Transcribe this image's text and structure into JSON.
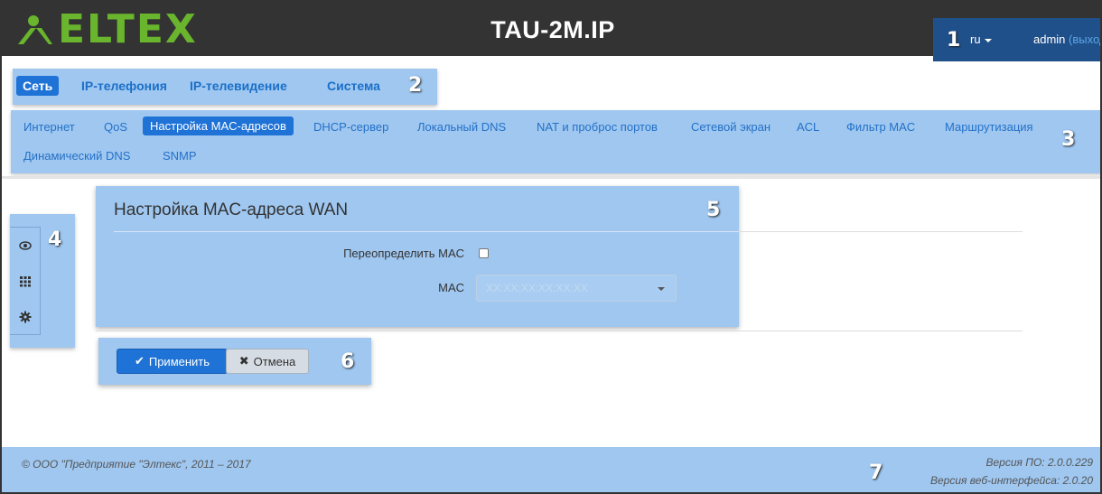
{
  "header": {
    "brand": "ELTEX",
    "title": "TAU-2M.IP",
    "language": "ru",
    "user": "admin",
    "logout": "(выход)"
  },
  "markers": [
    "1",
    "2",
    "3",
    "4",
    "5",
    "6",
    "7"
  ],
  "main_nav": [
    {
      "label": "Сеть",
      "active": true
    },
    {
      "label": "IP-телефония",
      "active": false
    },
    {
      "label": "IP-телевидение",
      "active": false
    },
    {
      "label": "Система",
      "active": false
    }
  ],
  "sub_nav": [
    {
      "label": "Интернет",
      "active": false
    },
    {
      "label": "QoS",
      "active": false
    },
    {
      "label": "Настройка MAC-адресов",
      "active": true
    },
    {
      "label": "DHCP-сервер",
      "active": false
    },
    {
      "label": "Локальный DNS",
      "active": false
    },
    {
      "label": "NAT и проброс портов",
      "active": false
    },
    {
      "label": "Сетевой экран",
      "active": false
    },
    {
      "label": "ACL",
      "active": false
    },
    {
      "label": "Фильтр MAC",
      "active": false
    },
    {
      "label": "Маршрутизация",
      "active": false
    },
    {
      "label": "Динамический DNS",
      "active": false
    },
    {
      "label": "SNMP",
      "active": false
    }
  ],
  "side_toolbar": {
    "icons": [
      "eye-icon",
      "grid-icon",
      "gear-icon"
    ]
  },
  "panel": {
    "title": "Настройка MAC-адреса WAN",
    "override_label": "Переопределить MAC",
    "override_checked": false,
    "mac_label": "MAC",
    "mac_placeholder": "XX:XX:XX:XX:XX:XX"
  },
  "actions": {
    "apply": "Применить",
    "cancel": "Отмена"
  },
  "footer": {
    "copyright": "© ООО \"Предприятие \"Элтекс\", 2011 – 2017",
    "firmware": "Версия ПО: 2.0.0.229",
    "web_version": "Версия веб-интерфейса: 2.0.20"
  },
  "colors": {
    "header_bg": "#333333",
    "accent": "#1f73d6",
    "highlight": "#9fc7f0",
    "brand": "#69b52d"
  }
}
